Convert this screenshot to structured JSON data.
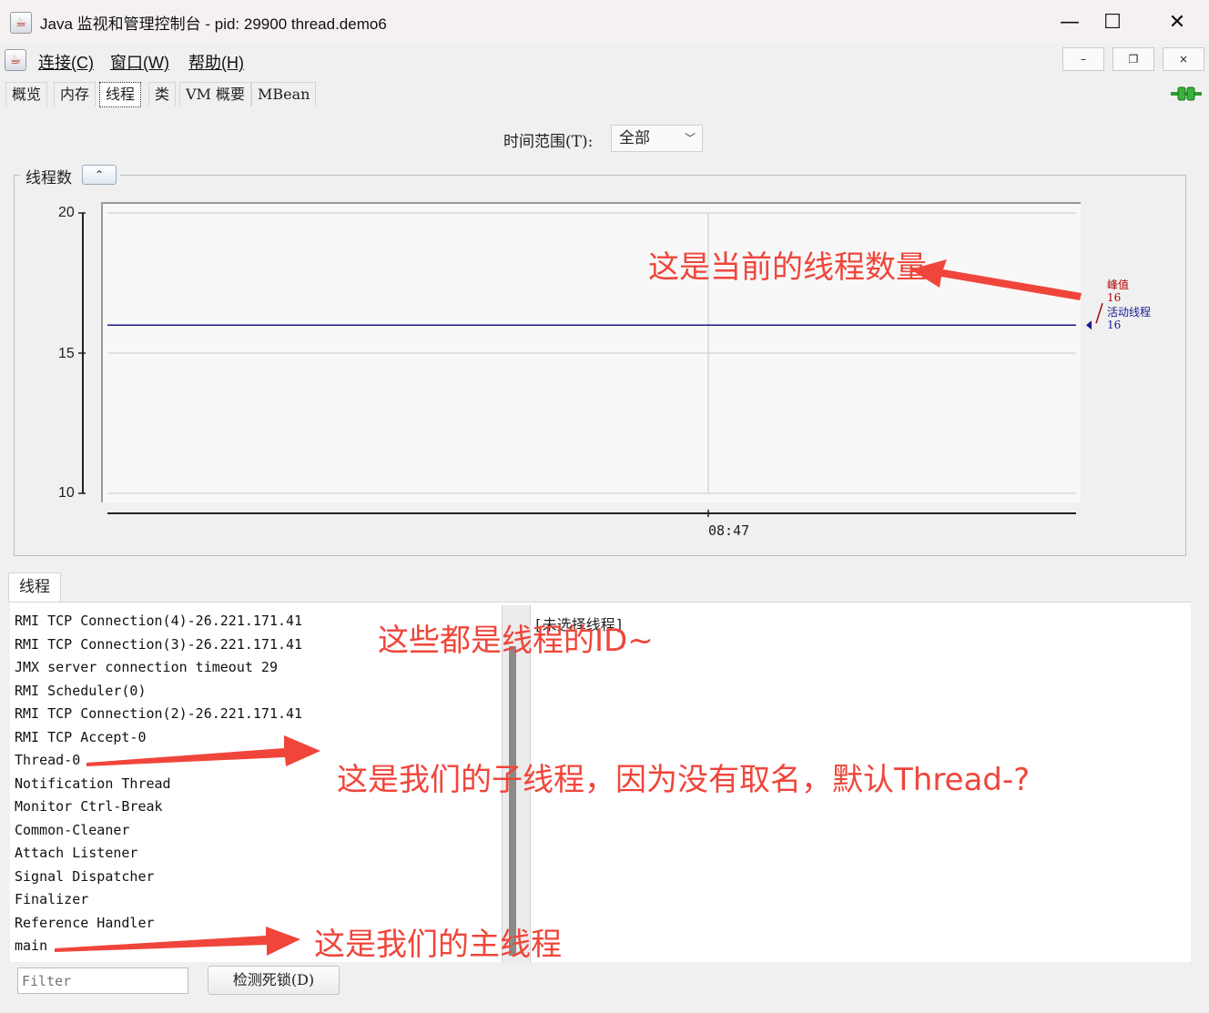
{
  "window": {
    "title": "Java 监视和管理控制台 - pid: 29900 thread.demo6",
    "minimize_glyph": "—",
    "maximize_glyph": "☐",
    "close_glyph": "✕"
  },
  "menubar": {
    "items": [
      {
        "label": "连接(C)"
      },
      {
        "label": "窗口(W)"
      },
      {
        "label": "帮助(H)"
      }
    ],
    "mdi_minimize": "–",
    "mdi_restore": "❐",
    "mdi_close": "×"
  },
  "tabs": [
    {
      "label": "概览"
    },
    {
      "label": "内存"
    },
    {
      "label": "线程",
      "selected": true
    },
    {
      "label": "类"
    },
    {
      "label": "VM 概要"
    },
    {
      "label": "MBean"
    }
  ],
  "time_range": {
    "label": "时间范围(T):",
    "value": "全部"
  },
  "chart_panel": {
    "title": "线程数",
    "collapse_glyph": "⌃"
  },
  "chart_data": {
    "type": "line",
    "y_ticks": [
      "20",
      "15",
      "10"
    ],
    "ylim": [
      10,
      20
    ],
    "x_ticks": [
      "08:47"
    ],
    "series": [
      {
        "name": "峰值",
        "value_label": "16",
        "values": [
          16,
          16
        ],
        "color": "#b00000"
      },
      {
        "name": "活动线程",
        "value_label": "16",
        "values": [
          16,
          16
        ],
        "color": "#1a1a8c"
      }
    ]
  },
  "threads_panel": {
    "tab_label": "线程",
    "threads": [
      "RMI TCP Connection(4)-26.221.171.41",
      "RMI TCP Connection(3)-26.221.171.41",
      "JMX server connection timeout 29",
      "RMI Scheduler(0)",
      "RMI TCP Connection(2)-26.221.171.41",
      "RMI TCP Accept-0",
      "Thread-0",
      "Notification Thread",
      "Monitor Ctrl-Break",
      "Common-Cleaner",
      "Attach Listener",
      "Signal Dispatcher",
      "Finalizer",
      "Reference Handler",
      "main"
    ],
    "detail_text": "[未选择线程]",
    "filter_placeholder": "Filter",
    "deadlock_button": "检测死锁(D)"
  },
  "annotations": {
    "thread_count": "这是当前的线程数量",
    "thread_ids": "这些都是线程的ID~",
    "child_thread": "这是我们的子线程，因为没有取名，默认Thread-?",
    "main_thread": "这是我们的主线程"
  },
  "colors": {
    "annotation": "#f0453a",
    "active_line": "#1a1a8c",
    "peak_label": "#b00000"
  }
}
